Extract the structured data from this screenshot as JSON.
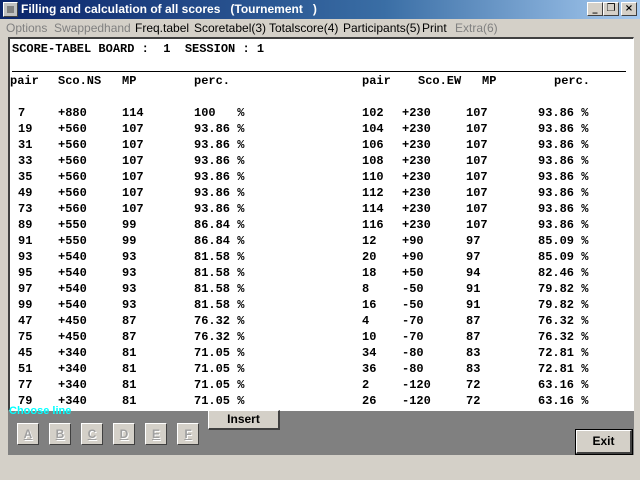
{
  "window": {
    "title": "Filling and calculation of all scores   (Tournement   )",
    "minimize_glyph": "_",
    "restore_glyph": "❐",
    "close_glyph": "×"
  },
  "menu": [
    {
      "label": "Options",
      "disabled": true
    },
    {
      "label": "Swappedhand",
      "disabled": true
    },
    {
      "label": "Freq.tabel",
      "disabled": false
    },
    {
      "label": "Scoretabel(3)",
      "disabled": false
    },
    {
      "label": "Totalscore(4)",
      "disabled": false
    },
    {
      "label": "Participants(5)",
      "disabled": false
    },
    {
      "label": "Print",
      "disabled": false
    },
    {
      "label": "Extra(6)",
      "disabled": true
    }
  ],
  "board": {
    "title": "SCORE-TABEL BOARD :  1  SESSION : 1",
    "headers": {
      "ns_pair": "pair",
      "ns_score": "Sco.NS",
      "ns_mp": "MP",
      "ns_perc": "perc.",
      "ew_pair": "pair",
      "ew_score": "Sco.EW",
      "ew_mp": "MP",
      "ew_perc": "perc."
    },
    "ns_rows": [
      {
        "pair": "7",
        "score": "+880",
        "mp": "114",
        "perc": "100   %"
      },
      {
        "pair": "19",
        "score": "+560",
        "mp": "107",
        "perc": "93.86 %"
      },
      {
        "pair": "31",
        "score": "+560",
        "mp": "107",
        "perc": "93.86 %"
      },
      {
        "pair": "33",
        "score": "+560",
        "mp": "107",
        "perc": "93.86 %"
      },
      {
        "pair": "35",
        "score": "+560",
        "mp": "107",
        "perc": "93.86 %"
      },
      {
        "pair": "49",
        "score": "+560",
        "mp": "107",
        "perc": "93.86 %"
      },
      {
        "pair": "73",
        "score": "+560",
        "mp": "107",
        "perc": "93.86 %"
      },
      {
        "pair": "89",
        "score": "+550",
        "mp": "99",
        "perc": "86.84 %"
      },
      {
        "pair": "91",
        "score": "+550",
        "mp": "99",
        "perc": "86.84 %"
      },
      {
        "pair": "93",
        "score": "+540",
        "mp": "93",
        "perc": "81.58 %"
      },
      {
        "pair": "95",
        "score": "+540",
        "mp": "93",
        "perc": "81.58 %"
      },
      {
        "pair": "97",
        "score": "+540",
        "mp": "93",
        "perc": "81.58 %"
      },
      {
        "pair": "99",
        "score": "+540",
        "mp": "93",
        "perc": "81.58 %"
      },
      {
        "pair": "47",
        "score": "+450",
        "mp": "87",
        "perc": "76.32 %"
      },
      {
        "pair": "75",
        "score": "+450",
        "mp": "87",
        "perc": "76.32 %"
      },
      {
        "pair": "45",
        "score": "+340",
        "mp": "81",
        "perc": "71.05 %"
      },
      {
        "pair": "51",
        "score": "+340",
        "mp": "81",
        "perc": "71.05 %"
      },
      {
        "pair": "77",
        "score": "+340",
        "mp": "81",
        "perc": "71.05 %"
      },
      {
        "pair": "79",
        "score": "+340",
        "mp": "81",
        "perc": "71.05 %"
      }
    ],
    "ew_rows": [
      {
        "pair": "102",
        "score": "+230",
        "mp": "107",
        "perc": "93.86 %"
      },
      {
        "pair": "104",
        "score": "+230",
        "mp": "107",
        "perc": "93.86 %"
      },
      {
        "pair": "106",
        "score": "+230",
        "mp": "107",
        "perc": "93.86 %"
      },
      {
        "pair": "108",
        "score": "+230",
        "mp": "107",
        "perc": "93.86 %"
      },
      {
        "pair": "110",
        "score": "+230",
        "mp": "107",
        "perc": "93.86 %"
      },
      {
        "pair": "112",
        "score": "+230",
        "mp": "107",
        "perc": "93.86 %"
      },
      {
        "pair": "114",
        "score": "+230",
        "mp": "107",
        "perc": "93.86 %"
      },
      {
        "pair": "116",
        "score": "+230",
        "mp": "107",
        "perc": "93.86 %"
      },
      {
        "pair": "12",
        "score": "+90",
        "mp": "97",
        "perc": "85.09 %"
      },
      {
        "pair": "20",
        "score": "+90",
        "mp": "97",
        "perc": "85.09 %"
      },
      {
        "pair": "18",
        "score": "+50",
        "mp": "94",
        "perc": "82.46 %"
      },
      {
        "pair": "8",
        "score": "-50",
        "mp": "91",
        "perc": "79.82 %"
      },
      {
        "pair": "16",
        "score": "-50",
        "mp": "91",
        "perc": "79.82 %"
      },
      {
        "pair": "4",
        "score": "-70",
        "mp": "87",
        "perc": "76.32 %"
      },
      {
        "pair": "10",
        "score": "-70",
        "mp": "87",
        "perc": "76.32 %"
      },
      {
        "pair": "34",
        "score": "-80",
        "mp": "83",
        "perc": "72.81 %"
      },
      {
        "pair": "36",
        "score": "-80",
        "mp": "83",
        "perc": "72.81 %"
      },
      {
        "pair": "2",
        "score": "-120",
        "mp": "72",
        "perc": "63.16 %"
      },
      {
        "pair": "26",
        "score": "-120",
        "mp": "72",
        "perc": "63.16 %"
      }
    ]
  },
  "bottom": {
    "choose_label": "Choose line",
    "letters": [
      "A",
      "B",
      "C",
      "D",
      "E",
      "F"
    ],
    "insert_label": "Insert",
    "exit_label": "Exit"
  },
  "colors": {
    "titlebar_start": "#0a246a",
    "titlebar_end": "#a6caf0",
    "choose_label": "#00ffff",
    "panel": "#808080"
  }
}
